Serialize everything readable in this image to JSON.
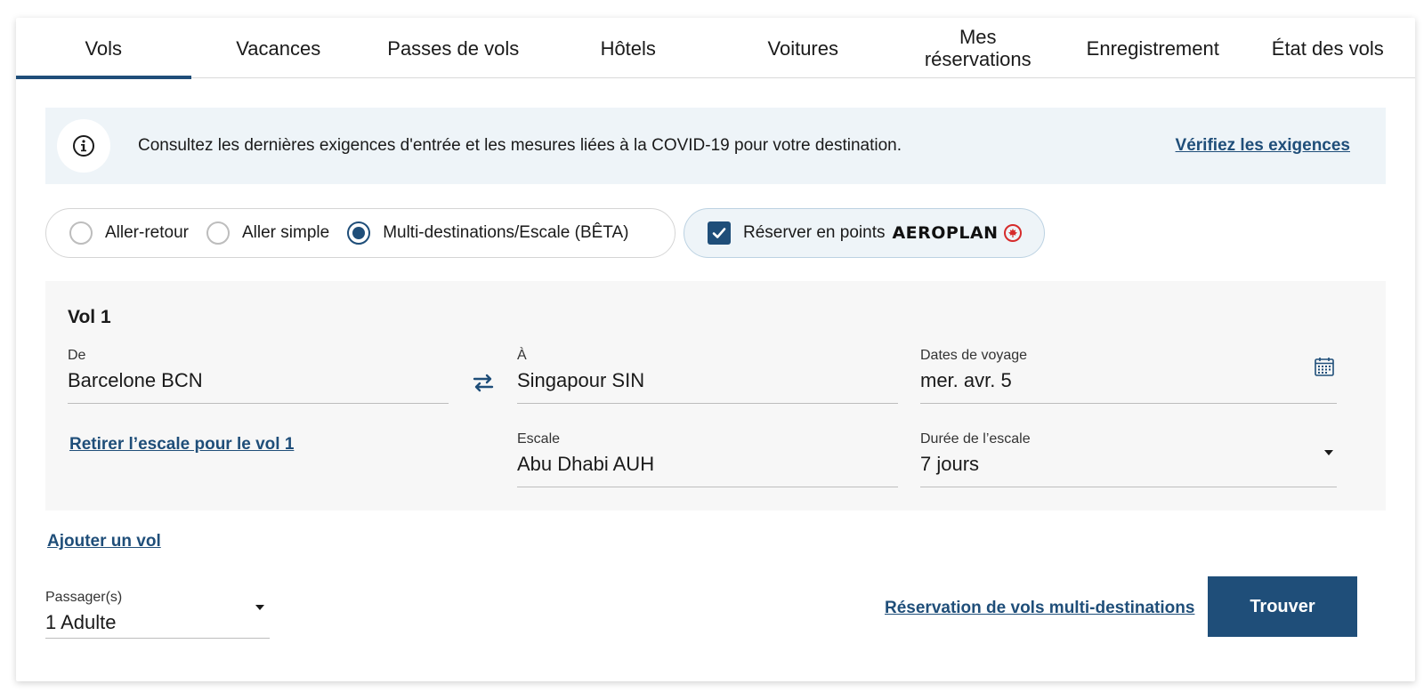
{
  "tabs": [
    {
      "label": "Vols",
      "active": true
    },
    {
      "label": "Vacances",
      "active": false
    },
    {
      "label": "Passes de vols",
      "active": false
    },
    {
      "label": "Hôtels",
      "active": false
    },
    {
      "label": "Voitures",
      "active": false
    },
    {
      "label": "Mes réservations",
      "active": false
    },
    {
      "label": "Enregistrement",
      "active": false
    },
    {
      "label": "État des vols",
      "active": false
    }
  ],
  "banner": {
    "icon": "info-icon",
    "text": "Consultez les dernières exigences d'entrée et les mesures liées à la COVID-19 pour votre destination.",
    "link": "Vérifiez les exigences"
  },
  "trip_type": {
    "options": [
      "Aller-retour",
      "Aller simple",
      "Multi-destinations/Escale (BÊTA)"
    ],
    "selected": "Multi-destinations/Escale (BÊTA)"
  },
  "points": {
    "label": "Réserver en points",
    "brand": "AEROPLAN",
    "checked": true
  },
  "flight": {
    "title": "Vol 1",
    "from": {
      "label": "De",
      "value": "Barcelone BCN"
    },
    "to": {
      "label": "À",
      "value": "Singapour SIN"
    },
    "dates": {
      "label": "Dates de voyage",
      "value": "mer. avr. 5"
    },
    "stopover": {
      "label": "Escale",
      "value": "Abu Dhabi AUH"
    },
    "stopover_duration": {
      "label": "Durée de l’escale",
      "value": "7 jours"
    },
    "remove_link": "Retirer l’escale pour le vol 1"
  },
  "add_flight": "Ajouter un vol",
  "passengers": {
    "label": "Passager(s)",
    "value": "1 Adulte"
  },
  "multi_link": "Réservation de vols multi-destinations",
  "find_button": "Trouver",
  "colors": {
    "accent": "#1f4e79",
    "banner_bg": "#eef4f8",
    "panel_bg": "#f7f7f7",
    "maple_red": "#d62b2b"
  }
}
